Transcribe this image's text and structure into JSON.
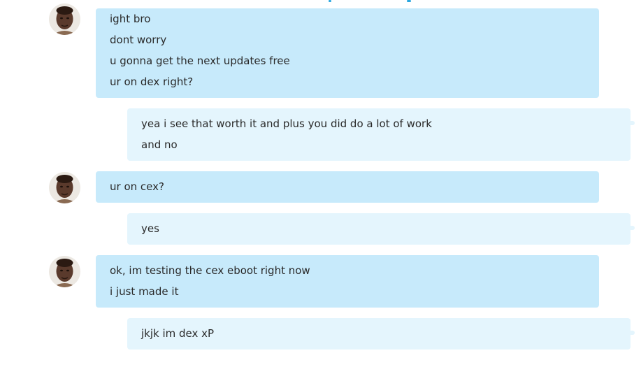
{
  "messages": [
    {
      "sender": "contact",
      "lines": [
        "ight bro",
        "dont worry",
        "u gonna get the next updates free",
        "ur on dex right?"
      ]
    },
    {
      "sender": "me",
      "lines": [
        "yea i see that worth it and plus you did do a lot of work",
        "and no"
      ]
    },
    {
      "sender": "contact",
      "lines": [
        "ur on cex?"
      ]
    },
    {
      "sender": "me",
      "lines": [
        "yes"
      ]
    },
    {
      "sender": "contact",
      "lines": [
        "ok, im testing the cex eboot right now",
        "i just made it"
      ]
    },
    {
      "sender": "me",
      "lines": [
        "jkjk im dex xP"
      ]
    }
  ],
  "colors": {
    "incoming_bubble": "#c7eafb",
    "outgoing_bubble": "#e4f5fd",
    "text": "#2a2a2a",
    "accent": "#2aa7df"
  },
  "icons": {
    "avatar": "contact-avatar"
  }
}
